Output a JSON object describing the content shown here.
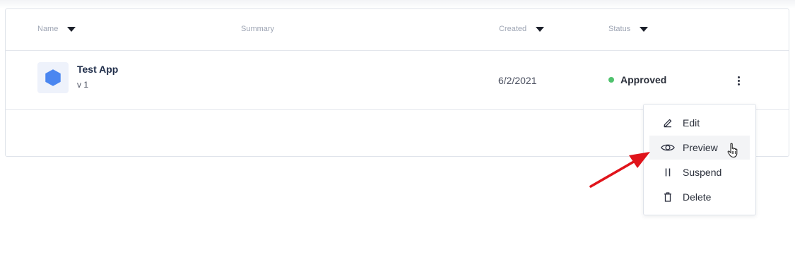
{
  "table": {
    "columns": {
      "name": "Name",
      "summary": "Summary",
      "created": "Created",
      "status": "Status"
    },
    "rows": [
      {
        "icon": "hexagon-icon",
        "name": "Test App",
        "version": "v 1",
        "summary": "",
        "created": "6/2/2021",
        "status": "Approved",
        "status_color": "#4fc26d"
      }
    ]
  },
  "row_menu": {
    "items": [
      {
        "label": "Edit",
        "icon": "pencil-icon"
      },
      {
        "label": "Preview",
        "icon": "eye-icon",
        "hovered": true
      },
      {
        "label": "Suspend",
        "icon": "pause-icon"
      },
      {
        "label": "Delete",
        "icon": "trash-icon"
      }
    ]
  },
  "colors": {
    "accent_icon": "#4a86f0",
    "annotation_arrow": "#e0141b",
    "status_approved": "#4fc26d"
  }
}
